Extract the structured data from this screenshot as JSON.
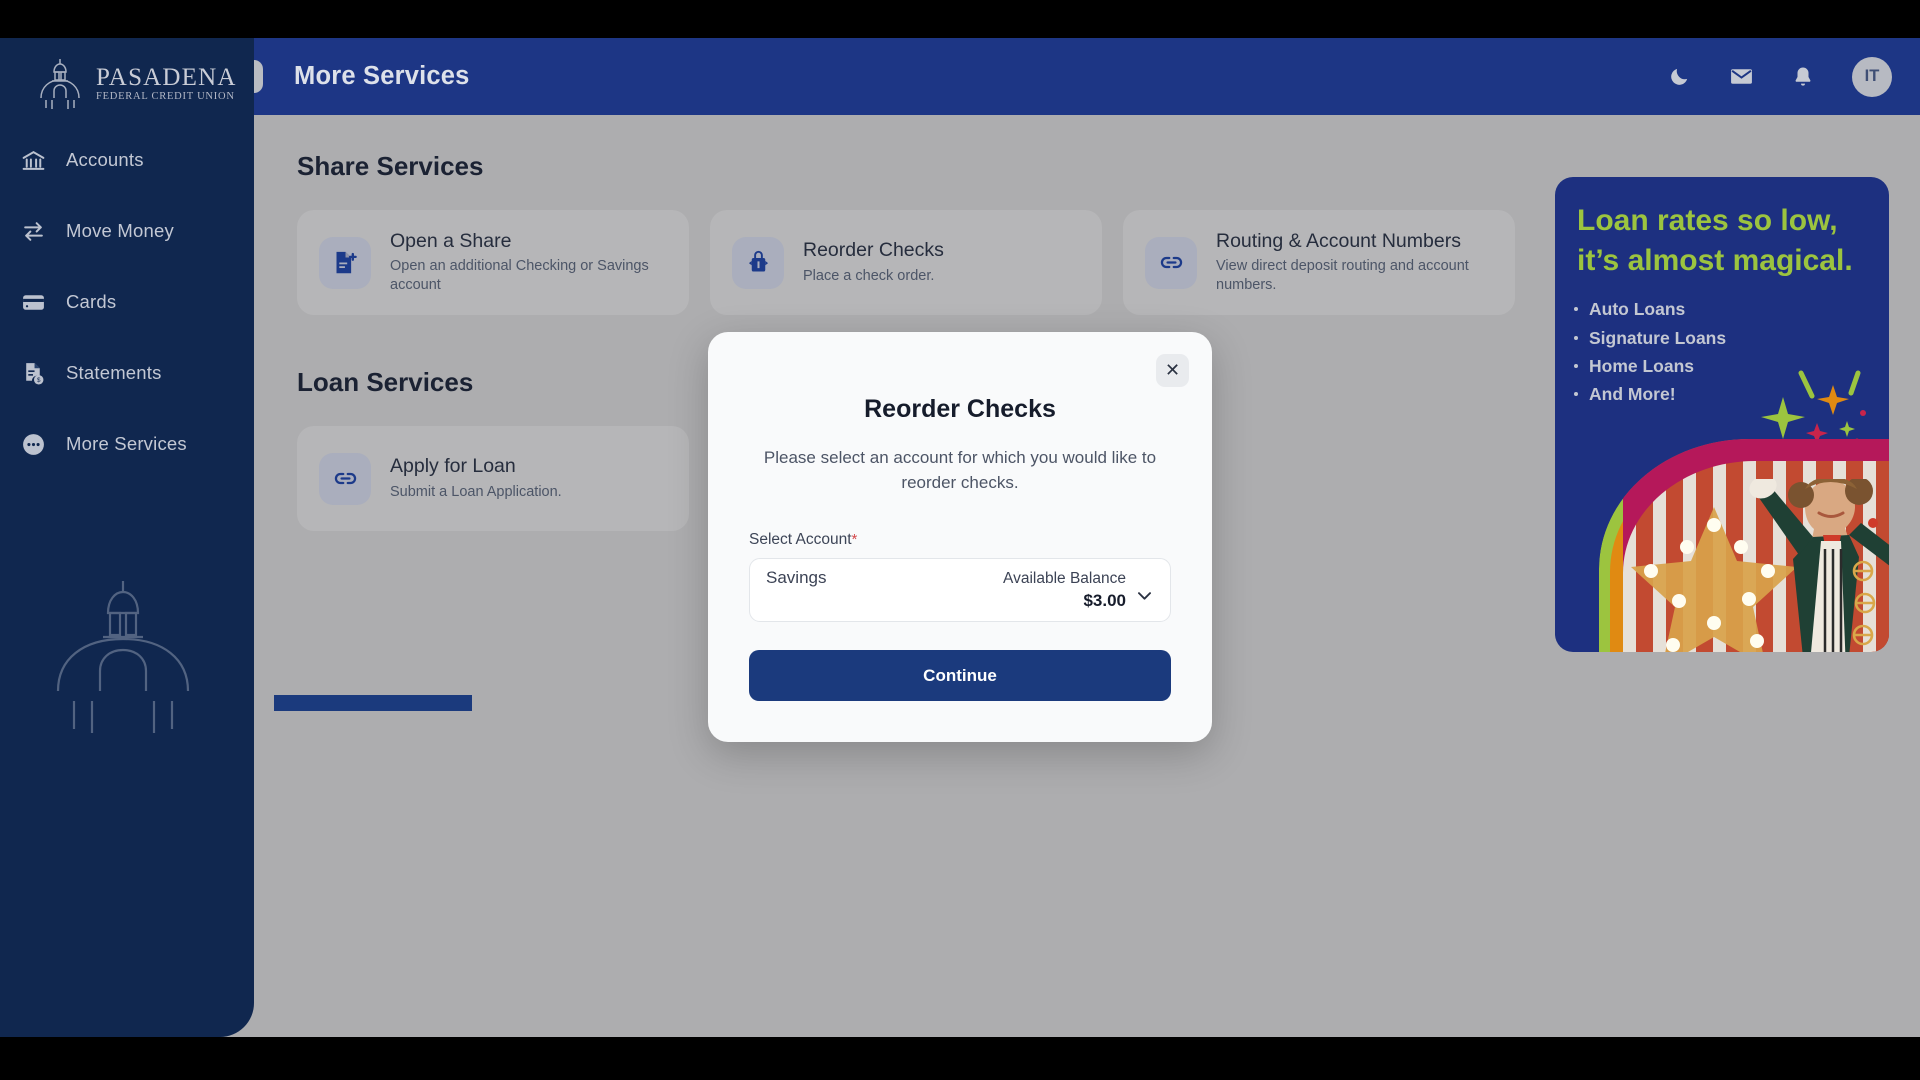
{
  "brand": {
    "name": "PASADENA",
    "subtitle": "FEDERAL CREDIT UNION",
    "logo_icon": "dome-building-icon"
  },
  "header": {
    "title": "More Services",
    "collapse_icon": "chevron-double-left-icon",
    "actions": [
      {
        "icon": "moon-icon",
        "name": "dark-mode-toggle"
      },
      {
        "icon": "envelope-icon",
        "name": "messages-button"
      },
      {
        "icon": "bell-icon",
        "name": "notifications-button"
      }
    ],
    "avatar_initials": "IT"
  },
  "sidebar": {
    "items": [
      {
        "label": "Accounts",
        "icon": "bank-icon"
      },
      {
        "label": "Move Money",
        "icon": "transfer-arrows-icon"
      },
      {
        "label": "Cards",
        "icon": "credit-card-icon"
      },
      {
        "label": "Statements",
        "icon": "document-dollar-icon"
      },
      {
        "label": "More Services",
        "icon": "ellipsis-circle-icon"
      }
    ]
  },
  "main": {
    "sections": [
      {
        "title": "Share Services",
        "cards": [
          {
            "title": "Open a Share",
            "desc": "Open an additional Checking or Savings account",
            "icon": "document-plus-icon"
          },
          {
            "title": "Reorder Checks",
            "desc": "Place a check order.",
            "icon": "checkbook-icon"
          },
          {
            "title": "Routing & Account Numbers",
            "desc": "View direct deposit routing and account numbers.",
            "icon": "link-icon"
          }
        ]
      },
      {
        "title": "Loan Services",
        "cards": [
          {
            "title": "Apply for Loan",
            "desc": "Submit a Loan Application.",
            "icon": "link-icon"
          }
        ]
      }
    ]
  },
  "promo": {
    "headline": "Loan rates so low, it’s almost magical.",
    "bullets": [
      "Auto Loans",
      "Signature Loans",
      "Home Loans",
      "And More!"
    ],
    "headline_color": "#9cc43f",
    "background_color": "#1d3080"
  },
  "modal": {
    "title": "Reorder Checks",
    "subtitle": "Please select an account for which you would like to reorder checks.",
    "close_icon": "close-icon",
    "field_label": "Select Account",
    "required_marker": "*",
    "account": {
      "name": "Savings",
      "balance_label": "Available Balance",
      "balance_value": "$3.00",
      "chevron_icon": "chevron-down-icon"
    },
    "continue_label": "Continue"
  },
  "colors": {
    "sidebar": "#10274f",
    "header": "#1d3685",
    "page_bg": "#adadaf",
    "primary": "#1b3a7d",
    "required": "#d4484b"
  }
}
